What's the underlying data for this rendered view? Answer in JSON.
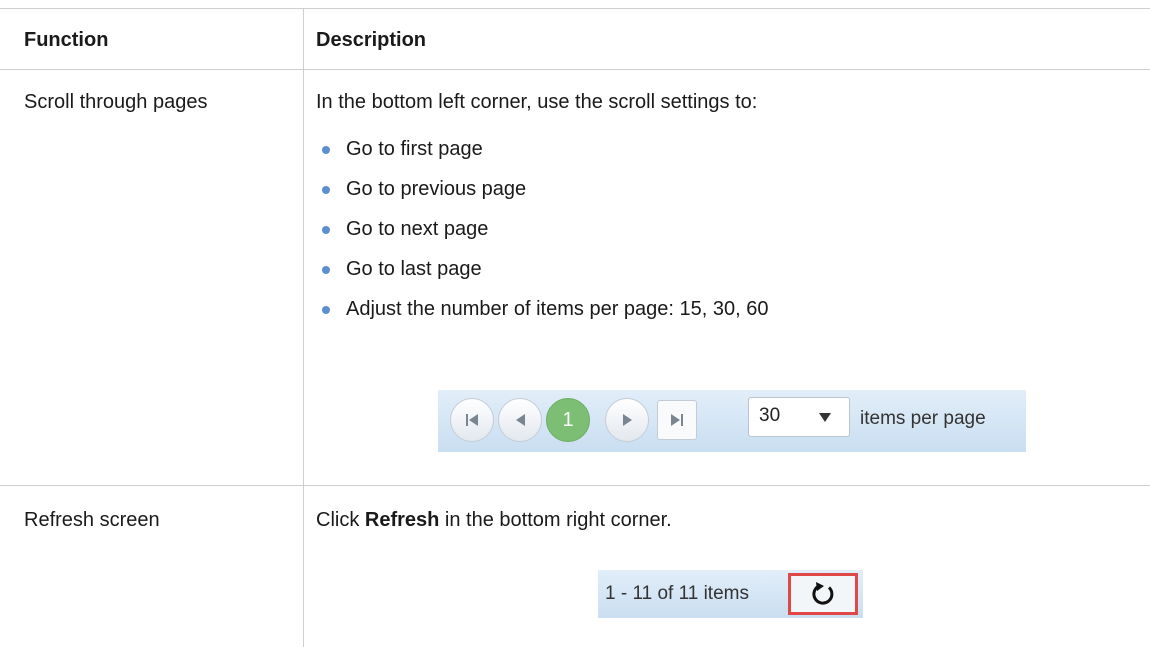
{
  "table": {
    "header": {
      "function": "Function",
      "description": "Description"
    },
    "row1": {
      "function": "Scroll through pages",
      "intro": "In the bottom left corner, use the scroll settings to:",
      "bullets": [
        "Go to first page",
        "Go to previous page",
        "Go to next page",
        "Go to last page",
        "Adjust the number of items per page: 15, 30, 60"
      ],
      "pager": {
        "current_page": "1",
        "page_size": "30",
        "items_per_page_label": "items per page",
        "icons": [
          "first-page-icon",
          "previous-page-icon",
          "next-page-icon",
          "last-page-icon"
        ]
      }
    },
    "row2": {
      "function": "Refresh screen",
      "desc_pre": "Click ",
      "desc_bold": "Refresh",
      "desc_post": " in the bottom right corner.",
      "count_label": "1 - 11 of 11 items",
      "refresh_icon": "refresh-icon"
    }
  },
  "colors": {
    "bullet": "#5b8fd0",
    "active_page": "#7cbf74",
    "highlight": "#e04848"
  }
}
